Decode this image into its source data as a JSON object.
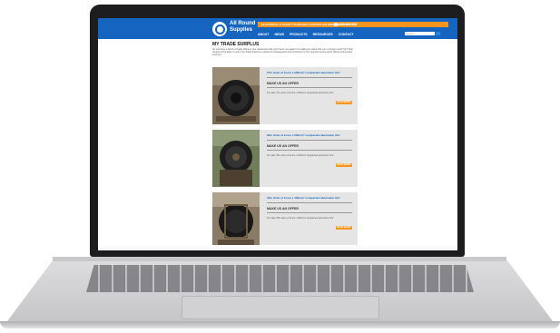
{
  "site": {
    "brand_line1": "All Round",
    "brand_line2": "Supplies",
    "top_strip": "ELECTRICAL & SAFETY SUPPLIES | AUSTRALIAN OWNED & OPERATED",
    "phone": "1300 307 171"
  },
  "nav": {
    "items": [
      "ABOUT",
      "NEWS",
      "PRODUCTS",
      "RESOURCES",
      "CONTACT"
    ],
    "search_placeholder": "Search..."
  },
  "page": {
    "title": "MY TRADE SURPLUS",
    "intro": "Do you have a bunch of cable sitting in your warehouse that you'll never use again? Is it taking up space that you no longer need? My Trade Surplus is the place to sell it. My Trade Surplus is a place for tradespeople and contractors to buy and sell excess stock, offcuts and surplus products."
  },
  "listings": [
    {
      "title": "27m drum of 1core x 630mm² compacted aluminium XLV",
      "offer": "MAKE US AN OFFER",
      "desc": "For sale: 27m drum of 1core x 630mm² compacted aluminium XLV",
      "button": "READ MORE"
    },
    {
      "title": "90m drum of 1core x 630mm² compacted aluminium XLV",
      "offer": "MAKE US AN OFFER",
      "desc": "For sale: 90m drum of 1core x 630mm² compacted aluminium XLV",
      "button": "READ MORE"
    },
    {
      "title": "45m drum of 1core x 400mm² compacted aluminium XLV",
      "offer": "MAKE US AN OFFER",
      "desc": "For sale: 45m drum of 1core x 400mm² compacted aluminium XLV",
      "button": "READ MORE"
    }
  ],
  "colors": {
    "primary": "#1565c0",
    "accent": "#f7941d",
    "card_bg": "#e5e5e5"
  }
}
